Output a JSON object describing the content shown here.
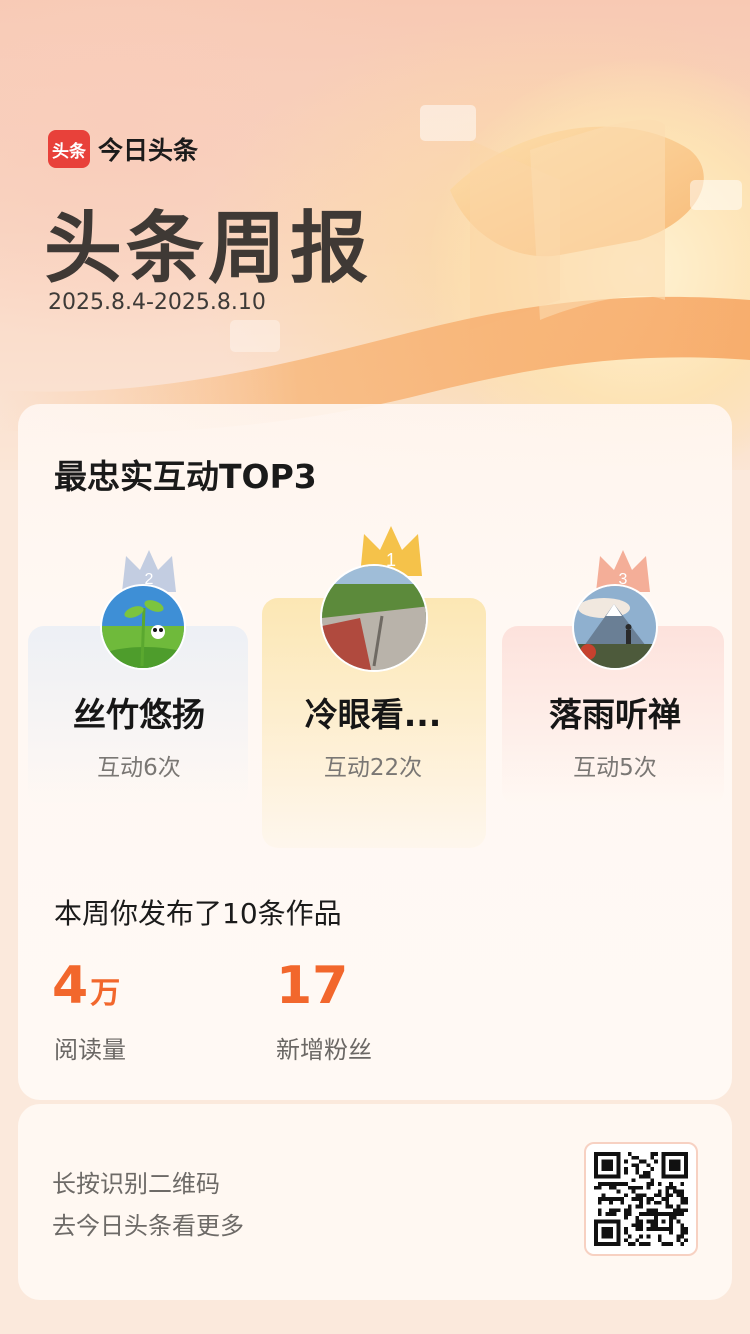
{
  "brand": {
    "logo_text": "头条",
    "name": "今日头条"
  },
  "header": {
    "title": "头条周报",
    "date_range": "2025.8.4-2025.8.10"
  },
  "interaction": {
    "title": "最忠实互动TOP3",
    "users": [
      {
        "rank": "2",
        "name": "丝竹悠扬",
        "count": "互动6次"
      },
      {
        "rank": "1",
        "name": "冷眼看...",
        "count": "互动22次"
      },
      {
        "rank": "3",
        "name": "落雨听禅",
        "count": "互动5次"
      }
    ]
  },
  "summary": {
    "publish_text": "本周你发布了10条作品",
    "reads": {
      "value": "4",
      "unit": "万",
      "label": "阅读量"
    },
    "followers": {
      "value": "17",
      "label": "新增粉丝"
    }
  },
  "qr": {
    "line1": "长按识别二维码",
    "line2": "去今日头条看更多"
  },
  "colors": {
    "accent": "#f2672c",
    "brand_red": "#e8413a",
    "gold": "#f5c24a",
    "silver": "#b9c6de",
    "bronze": "#f3a58e"
  },
  "icons": [
    "crown-gold-icon",
    "crown-silver-icon",
    "crown-bronze-icon",
    "qr-code"
  ]
}
